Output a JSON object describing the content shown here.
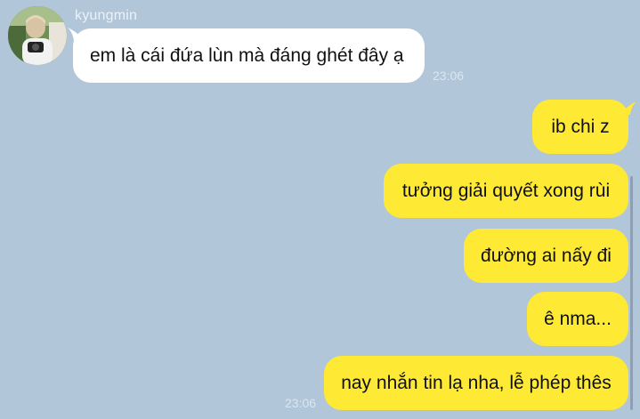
{
  "contact": {
    "name": "kyungmin"
  },
  "messages": {
    "incoming": [
      {
        "text": "em là cái đứa lùn mà đáng ghét đây ạ",
        "time": "23:06"
      }
    ],
    "outgoing": [
      {
        "text": "ib chi z"
      },
      {
        "text": "tưởng giải quyết xong rùi"
      },
      {
        "text": "đường ai nấy đi"
      },
      {
        "text": "ê nma..."
      },
      {
        "text": "nay nhắn tin lạ nha, lễ phép thês"
      }
    ],
    "outgoing_time": "23:06"
  },
  "colors": {
    "background": "#b1c6d9",
    "incoming_bubble": "#ffffff",
    "outgoing_bubble": "#fee934",
    "timestamp": "#dce6f0",
    "sender_name": "#edf2f7"
  }
}
